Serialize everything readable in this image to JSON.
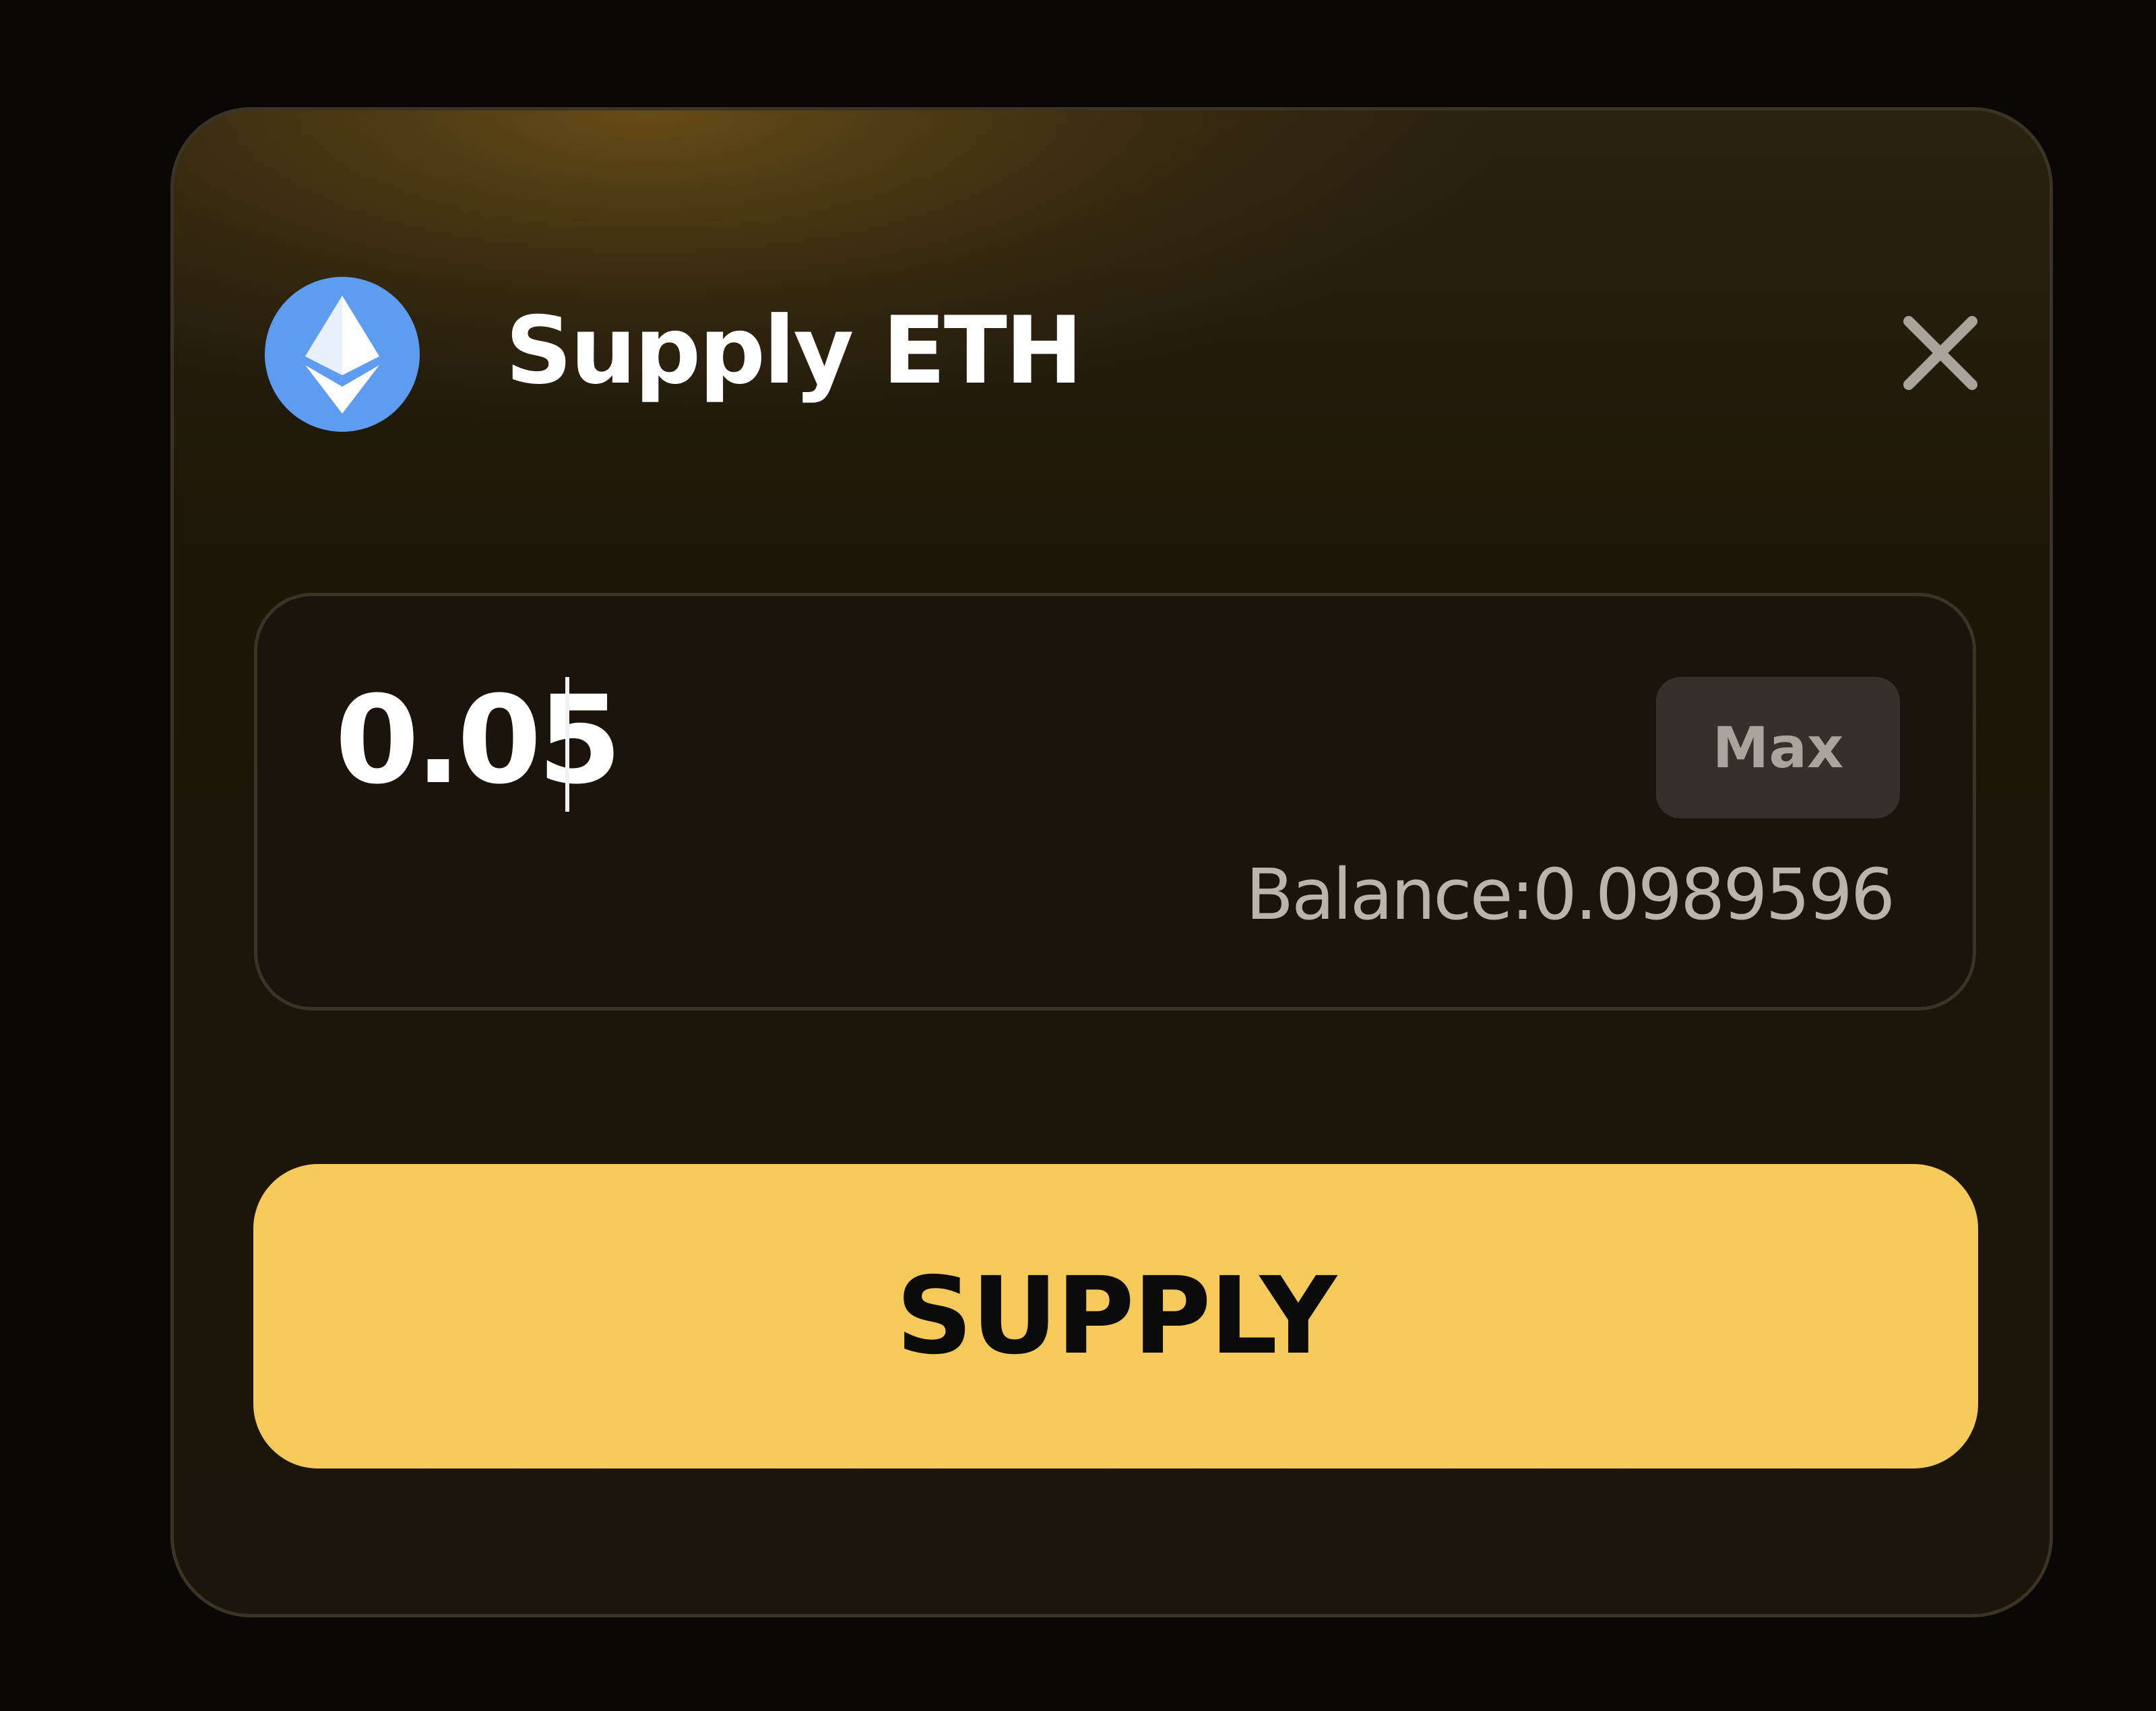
{
  "modal": {
    "title": "Supply ETH",
    "token_icon": "ethereum-icon",
    "close_icon": "close-icon"
  },
  "amount": {
    "value": "0.05",
    "max_label": "Max",
    "balance_text": "Balance:0.0989596"
  },
  "actions": {
    "supply_label": "SUPPLY"
  },
  "colors": {
    "accent": "#f6c95b",
    "eth_blue": "#5e9cf0",
    "background": "#1b150b"
  }
}
